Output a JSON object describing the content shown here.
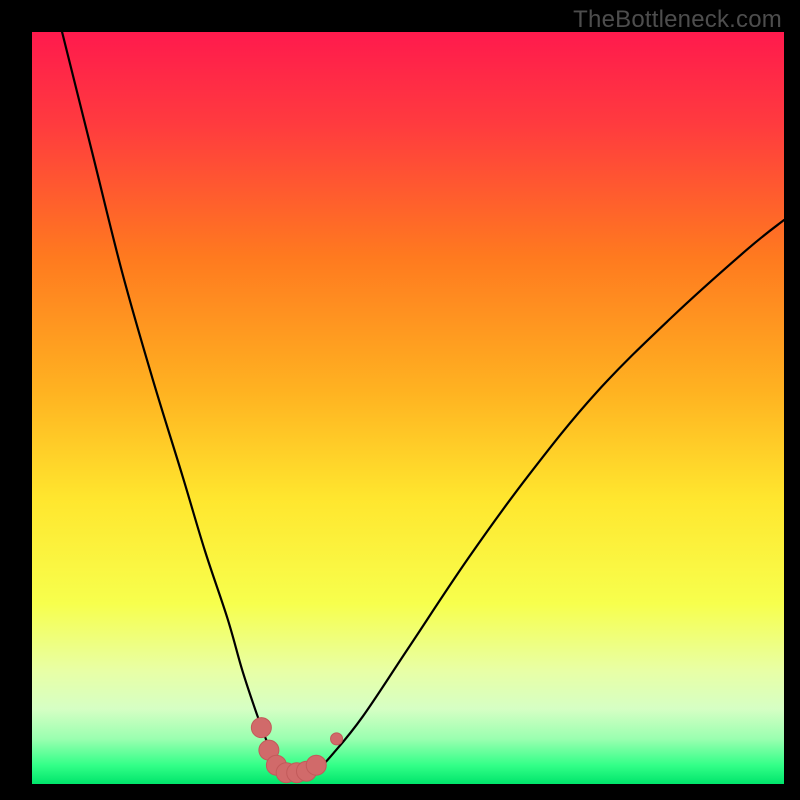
{
  "watermark": "TheBottleneck.com",
  "colors": {
    "black": "#000000",
    "curve": "#000000",
    "marker_fill": "#d16a6a",
    "marker_stroke": "#c25a5a"
  },
  "chart_data": {
    "type": "line",
    "title": "",
    "xlabel": "",
    "ylabel": "",
    "xlim": [
      0,
      100
    ],
    "ylim": [
      0,
      100
    ],
    "gradient_stops": [
      {
        "offset": 0.0,
        "color": "#ff1a4d"
      },
      {
        "offset": 0.12,
        "color": "#ff3a3f"
      },
      {
        "offset": 0.3,
        "color": "#ff7a1f"
      },
      {
        "offset": 0.48,
        "color": "#ffb321"
      },
      {
        "offset": 0.62,
        "color": "#ffe62e"
      },
      {
        "offset": 0.76,
        "color": "#f7ff4d"
      },
      {
        "offset": 0.85,
        "color": "#e8ffa6"
      },
      {
        "offset": 0.9,
        "color": "#d6ffc4"
      },
      {
        "offset": 0.94,
        "color": "#9affb0"
      },
      {
        "offset": 0.975,
        "color": "#33ff88"
      },
      {
        "offset": 1.0,
        "color": "#00e56b"
      }
    ],
    "series": [
      {
        "name": "bottleneck-curve",
        "x": [
          4,
          8,
          12,
          16,
          20,
          23,
          26,
          28,
          30,
          31.5,
          33,
          34.5,
          36,
          38,
          40,
          44,
          50,
          58,
          66,
          75,
          85,
          95,
          100
        ],
        "y": [
          100,
          84,
          68,
          54,
          41,
          31,
          22,
          15,
          9,
          5,
          2,
          1,
          1,
          2,
          4,
          9,
          18,
          30,
          41,
          52,
          62,
          71,
          75
        ]
      }
    ],
    "markers": {
      "name": "highlighted-range",
      "points": [
        {
          "x": 30.5,
          "y": 7.5
        },
        {
          "x": 31.5,
          "y": 4.5
        },
        {
          "x": 32.5,
          "y": 2.5
        },
        {
          "x": 33.8,
          "y": 1.5
        },
        {
          "x": 35.2,
          "y": 1.5
        },
        {
          "x": 36.5,
          "y": 1.7
        },
        {
          "x": 37.8,
          "y": 2.5
        },
        {
          "x": 40.5,
          "y": 6.0
        }
      ],
      "radius_main": 10,
      "radius_outlier": 6
    }
  }
}
